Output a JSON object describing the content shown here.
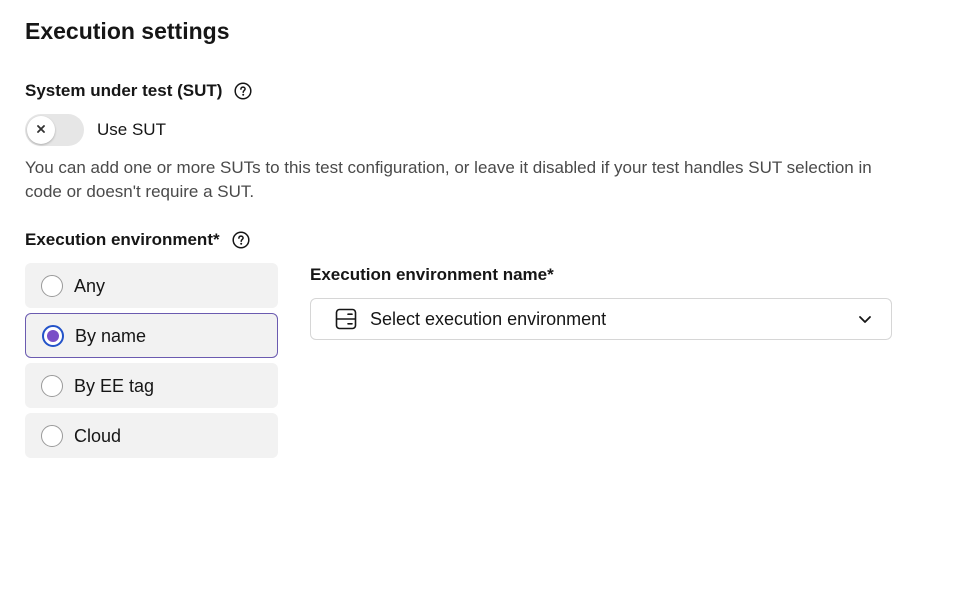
{
  "page": {
    "title": "Execution settings"
  },
  "sut": {
    "label": "System under test (SUT)",
    "help_icon": "help-circle-icon",
    "toggle_label": "Use SUT",
    "toggle_on": false,
    "helper_text": "You can add one or more SUTs to this test configuration, or leave it disabled if your test handles SUT selection in code or doesn't require a SUT."
  },
  "execution_environment": {
    "label": "Execution environment*",
    "help_icon": "help-circle-icon",
    "options": [
      {
        "label": "Any",
        "selected": false
      },
      {
        "label": "By name",
        "selected": true
      },
      {
        "label": "By EE tag",
        "selected": false
      },
      {
        "label": "Cloud",
        "selected": false
      }
    ],
    "name_field": {
      "label": "Execution environment name*",
      "placeholder": "Select execution environment",
      "icon": "server-icon",
      "chevron": "chevron-down-icon"
    }
  },
  "colors": {
    "radio_selected_ring": "#2353c9",
    "radio_selected_fill": "#7a4fc7",
    "selected_border": "#6b5bb0",
    "card_bg": "#f2f2f2"
  }
}
